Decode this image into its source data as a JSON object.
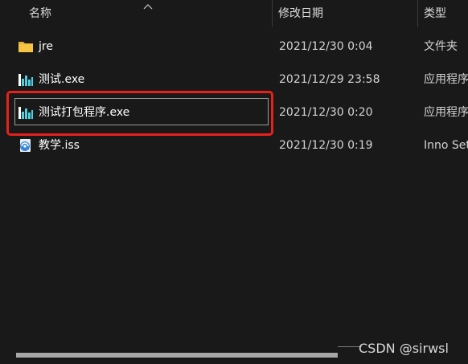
{
  "columns": {
    "name": "名称",
    "date_modified": "修改日期",
    "type": "类型"
  },
  "sort_indicator_icon": "chevron-up-icon",
  "files": [
    {
      "name": "jre",
      "date": "2021/12/30 0:04",
      "type": "文件夹",
      "icon": "folder-icon"
    },
    {
      "name": "测试.exe",
      "date": "2021/12/29 23:58",
      "type": "应用程序",
      "icon": "exe-app-icon"
    },
    {
      "name": "测试打包程序.exe",
      "date": "2021/12/30 0:20",
      "type": "应用程序",
      "icon": "exe-app-icon",
      "selected": true,
      "highlighted": true
    },
    {
      "name": "教学.iss",
      "date": "2021/12/30 0:19",
      "type": "Inno Setup Script",
      "icon": "inno-script-icon"
    }
  ],
  "watermark": "CSDN @sirwsl",
  "colors": {
    "background": "#191919",
    "highlight_border": "#e8201c",
    "folder": "#f6c342",
    "exe_icon": "#4fd0e0"
  }
}
